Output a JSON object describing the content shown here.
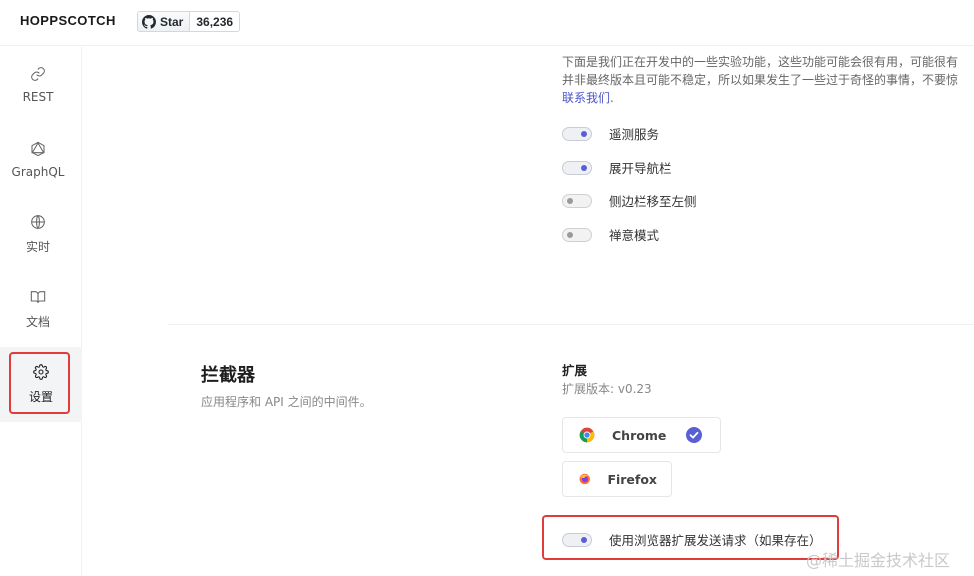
{
  "header": {
    "brand": "HOPPSCOTCH",
    "github_star_label": "Star",
    "github_star_count": "36,236"
  },
  "sidebar": {
    "items": [
      {
        "label": "REST",
        "icon": "link-icon"
      },
      {
        "label": "GraphQL",
        "icon": "graphql-icon"
      },
      {
        "label": "实时",
        "icon": "globe-icon"
      },
      {
        "label": "文档",
        "icon": "book-icon"
      },
      {
        "label": "设置",
        "icon": "gear-icon",
        "active": true
      }
    ]
  },
  "experiments": {
    "description_line1": "下面是我们正在开发中的一些实验功能，这些功能可能会很有用，可能很有",
    "description_line2": "并非最终版本且可能不稳定，所以如果发生了一些过于奇怪的事情，不要惊",
    "contact_link": "联系我们",
    "contact_suffix": ".",
    "toggles": [
      {
        "label": "遥测服务",
        "on": true
      },
      {
        "label": "展开导航栏",
        "on": true
      },
      {
        "label": "侧边栏移至左侧",
        "on": false
      },
      {
        "label": "禅意模式",
        "on": false
      }
    ]
  },
  "interceptor": {
    "title": "拦截器",
    "subtitle": "应用程序和 API 之间的中间件。",
    "extension_title": "扩展",
    "extension_version": "扩展版本: v0.23",
    "browsers": [
      {
        "label": "Chrome",
        "icon": "chrome-icon",
        "checked": true
      },
      {
        "label": "Firefox",
        "icon": "firefox-icon",
        "checked": false
      }
    ],
    "use_extension_toggle": {
      "label": "使用浏览器扩展发送请求（如果存在）",
      "on": true
    }
  },
  "watermark": "@稀土掘金技术社区",
  "colors": {
    "accent": "#5a5fd6",
    "highlight_box": "#e23b3b",
    "link": "#4c54c7"
  }
}
